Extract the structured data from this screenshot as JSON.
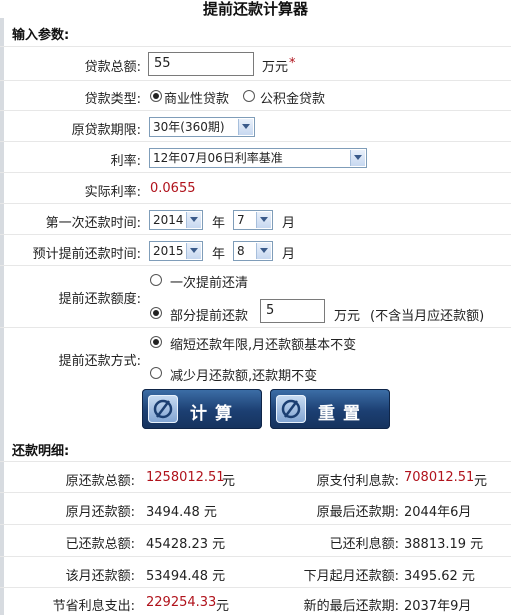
{
  "title": "提前还款计算器",
  "input_section": "输入参数:",
  "loan_amount": {
    "label": "贷款总额:",
    "value": "55",
    "unit": "万元",
    "required_mark": "*"
  },
  "loan_type": {
    "label": "贷款类型:",
    "options": [
      "商业性贷款",
      "公积金贷款"
    ],
    "selected": "商业性贷款"
  },
  "loan_term": {
    "label": "原贷款期限:",
    "value": "30年(360期)"
  },
  "rate": {
    "label": "利率:",
    "value": "12年07月06日利率基准"
  },
  "actual_rate": {
    "label": "实际利率:",
    "value": "0.0655"
  },
  "first_payment": {
    "label": "第一次还款时间:",
    "year": "2014",
    "year_unit": "年",
    "month": "7",
    "month_unit": "月"
  },
  "planned_prepay": {
    "label": "预计提前还款时间:",
    "year": "2015",
    "year_unit": "年",
    "month": "8",
    "month_unit": "月"
  },
  "prepay_amount": {
    "label": "提前还款额度:",
    "option_full": "一次提前还清",
    "option_partial": "部分提前还款",
    "partial_value": "5",
    "unit": "万元",
    "note": "(不含当月应还款额)",
    "selected": "部分提前还款"
  },
  "prepay_method": {
    "label": "提前还款方式:",
    "option_shorten": "缩短还款年限,月还款额基本不变",
    "option_reduce": "减少月还款额,还款期不变",
    "selected": "缩短还款年限,月还款额基本不变"
  },
  "buttons": {
    "calculate": "计算",
    "reset": "重置"
  },
  "result_section": "还款明细:",
  "results": {
    "orig_total_label": "原还款总额:",
    "orig_total_value": "1258012.51",
    "orig_total_unit": "元",
    "orig_interest_label": "原支付利息款:",
    "orig_interest_value": "708012.51",
    "orig_interest_unit": "元",
    "orig_monthly_label": "原月还款额:",
    "orig_monthly_value": "3494.48 元",
    "orig_last_label": "原最后还款期:",
    "orig_last_value": "2044年6月",
    "paid_total_label": "已还款总额:",
    "paid_total_value": "45428.23 元",
    "paid_interest_label": "已还利息额:",
    "paid_interest_value": "38813.19 元",
    "this_month_label": "该月还款额:",
    "this_month_value": "53494.48 元",
    "next_monthly_label": "下月起月还款额:",
    "next_monthly_value": "3495.62 元",
    "saved_interest_label": "节省利息支出:",
    "saved_interest_value": "229254.33",
    "saved_interest_unit": "元",
    "new_last_label": "新的最后还款期:",
    "new_last_value": "2037年9月"
  }
}
